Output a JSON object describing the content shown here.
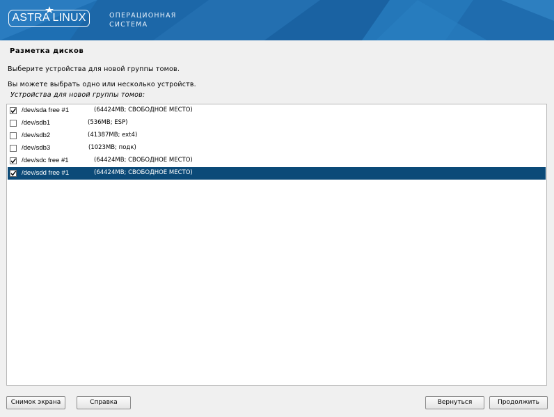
{
  "banner": {
    "logo_text": "ASTRA LINUX",
    "caption_line1": "ОПЕРАЦИОННАЯ",
    "caption_line2": "СИСТЕМА",
    "bg_color": "#1e6fb3"
  },
  "page": {
    "title": "Разметка дисков",
    "instruction1": "Выберите устройства для новой группы томов.",
    "instruction2": "Вы можете выбрать одно или несколько устройств.",
    "list_label": "Устройства для новой группы томов:"
  },
  "devices": [
    {
      "name": "/dev/sda free #1",
      "info": "(64424MB; СВОБОДНОЕ МЕСТО)",
      "checked": true,
      "selected": false
    },
    {
      "name": "/dev/sdb1",
      "info": "(536MB; ESP)",
      "checked": false,
      "selected": false
    },
    {
      "name": "/dev/sdb2",
      "info": "(41387MB; ext4)",
      "checked": false,
      "selected": false
    },
    {
      "name": "/dev/sdb3",
      "info": "(1023MB; подк)",
      "checked": false,
      "selected": false
    },
    {
      "name": "/dev/sdc free #1",
      "info": "(64424MB; СВОБОДНОЕ МЕСТО)",
      "checked": true,
      "selected": false
    },
    {
      "name": "/dev/sdd free #1",
      "info": "(64424MB; СВОБОДНОЕ МЕСТО)",
      "checked": true,
      "selected": true
    }
  ],
  "buttons": {
    "screenshot": "Снимок экрана",
    "help": "Справка",
    "back": "Вернуться",
    "continue": "Продолжить"
  },
  "colors": {
    "selection": "#0b4a78"
  }
}
